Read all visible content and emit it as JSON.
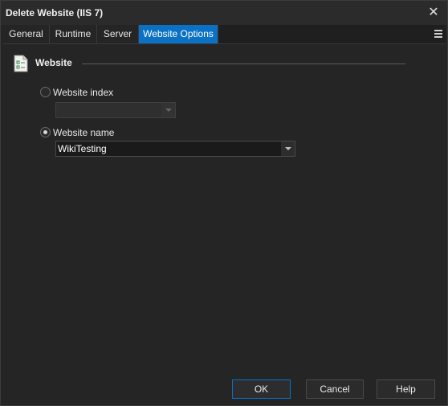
{
  "window": {
    "title": "Delete Website (IIS 7)"
  },
  "tabs": [
    "General",
    "Runtime",
    "Server",
    "Website Options"
  ],
  "active_tab": "Website Options",
  "section": {
    "title": "Website"
  },
  "website_index": {
    "label": "Website index",
    "selected": false,
    "value": ""
  },
  "website_name": {
    "label": "Website name",
    "selected": true,
    "value": "WikiTesting"
  },
  "buttons": {
    "ok": "OK",
    "cancel": "Cancel",
    "help": "Help"
  },
  "colors": {
    "accent": "#0a71c4",
    "background": "#252526"
  },
  "icons": {
    "close": "close-icon",
    "menu": "menu-icon",
    "section": "checklist-document-icon"
  }
}
